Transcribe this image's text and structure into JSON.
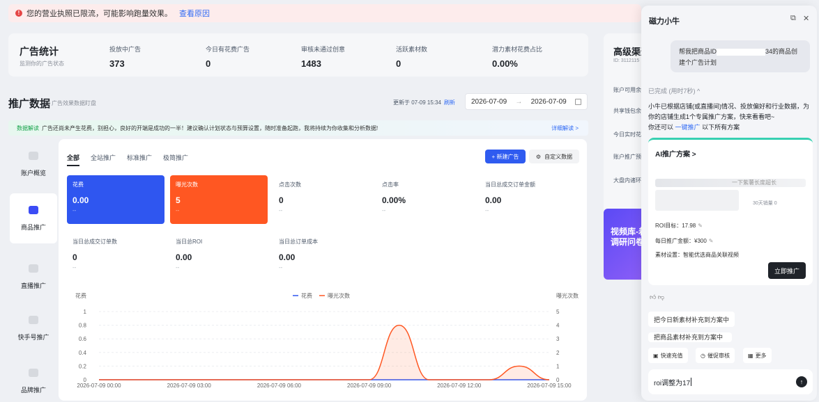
{
  "alert": {
    "text": "您的营业执照已限流，可能影响跑量效果。",
    "link": "查看原因"
  },
  "stats": {
    "title": "广告统计",
    "subtitle": "监测你的广告状态",
    "items": [
      {
        "label": "投放中广告",
        "value": "373"
      },
      {
        "label": "今日有花费广告",
        "value": "0"
      },
      {
        "label": "审核未通过创意",
        "value": "1483"
      },
      {
        "label": "活跃素材数",
        "value": "0"
      },
      {
        "label": "潜力素材花费占比",
        "value": "0.00%"
      }
    ]
  },
  "promo": {
    "title": "推广数据",
    "subtitle": "广告效果数据盯盘",
    "updated": "更新于 07-09 15:34",
    "refresh": "刷新",
    "date_start": "2026-07-09",
    "date_end": "2026-07-09",
    "arrow": "→",
    "tip_tag": "数据解读",
    "tip_text": "广告还尚未产生花费，别担心，良好的开端是成功的一半！建议确认计划状态与预算设置，随时准备起跑，我将持续为你收集和分析数据!",
    "tip_more": "详细解读 >"
  },
  "sidenav": [
    {
      "label": "账户概览",
      "active": false
    },
    {
      "label": "商品推广",
      "active": true
    },
    {
      "label": "直播推广",
      "active": false
    },
    {
      "label": "快手号推广",
      "active": false
    },
    {
      "label": "品牌推广",
      "active": false
    }
  ],
  "tabs": [
    "全部",
    "全站推广",
    "标准推广",
    "极简推广"
  ],
  "buttons": {
    "new_ad": "+ 新建广告",
    "custom": "自定义数据"
  },
  "metrics": [
    {
      "label": "花费",
      "value": "0.00",
      "delta": "--",
      "style": "blue"
    },
    {
      "label": "曝光次数",
      "value": "5",
      "delta": "--",
      "style": "red"
    },
    {
      "label": "点击次数",
      "value": "0",
      "delta": "--",
      "style": "plain"
    },
    {
      "label": "点击率",
      "value": "0.00%",
      "delta": "--",
      "style": "plain"
    },
    {
      "label": "当日总成交订单金额",
      "value": "0.00",
      "delta": "--",
      "style": "plain"
    },
    {
      "label": "当日总成交订单数",
      "value": "0",
      "delta": "--",
      "style": "plain"
    },
    {
      "label": "当日总ROI",
      "value": "0.00",
      "delta": "--",
      "style": "plain"
    },
    {
      "label": "当日总订单成本",
      "value": "0.00",
      "delta": "--",
      "style": "plain"
    }
  ],
  "chart_data": {
    "type": "line",
    "ylabel_left": "花费",
    "ylabel_right": "曝光次数",
    "left_ticks": [
      "0",
      "0.2",
      "0.4",
      "0.6",
      "0.8",
      "1"
    ],
    "right_ticks": [
      "0",
      "1",
      "2",
      "3",
      "4",
      "5"
    ],
    "x_ticks": [
      "2026-07-09 00:00",
      "2026-07-09 03:00",
      "2026-07-09 06:00",
      "2026-07-09 09:00",
      "2026-07-09 12:00",
      "2026-07-09 15:00"
    ],
    "series": [
      {
        "name": "花费",
        "color": "#2f56f0",
        "values": [
          0,
          0,
          0,
          0,
          0,
          0,
          0,
          0,
          0,
          0,
          0,
          0,
          0,
          0,
          0,
          0
        ]
      },
      {
        "name": "曝光次数",
        "color": "#ff5722",
        "values": [
          0,
          0,
          0,
          0,
          0,
          0,
          0,
          0,
          0,
          0,
          4,
          0,
          0,
          0,
          1,
          0
        ]
      }
    ],
    "hours": [
      0,
      1,
      2,
      3,
      4,
      5,
      6,
      7,
      8,
      9,
      10,
      11,
      12,
      13,
      14,
      15
    ]
  },
  "right": {
    "title": "高级渠道",
    "id": "ID: 3112115",
    "rows": [
      "账户可用余",
      "共享钱包余",
      "今日实时花",
      "账户推广预",
      "大盘内诸环"
    ],
    "banner": "视频库-着\n调研问卷"
  },
  "assistant": {
    "title": "磁力小牛",
    "user_msg_a": "帮我把商品ID",
    "user_msg_b": "34的商品创建个广告计划",
    "done": "已完成 (用时7秒) ^",
    "reply_1": "小牛已根据店铺(或直播间)情况、投放偏好和行业数据，为你的店铺生成1个专属推广方案，快来看看吧~",
    "reply_2a": "你还可以",
    "reply_link": "一键推广",
    "reply_2b": "以下所有方案",
    "card_title": "AI推广方案 >",
    "card_blur": "一下紫薯长度超长",
    "sales": "30天销量 0",
    "roi": "ROI目标：17.98",
    "budget": "每日推广金额：¥300",
    "material": "素材设置：智能优选商品关联视频",
    "promote_btn": "立即推广",
    "suggestions": [
      "把今日新素材补充到方案中",
      "把商品素材补充到方案中"
    ],
    "quick": [
      "快速充值",
      "催促审核",
      "更多"
    ],
    "input_value": "roi调整为17"
  }
}
